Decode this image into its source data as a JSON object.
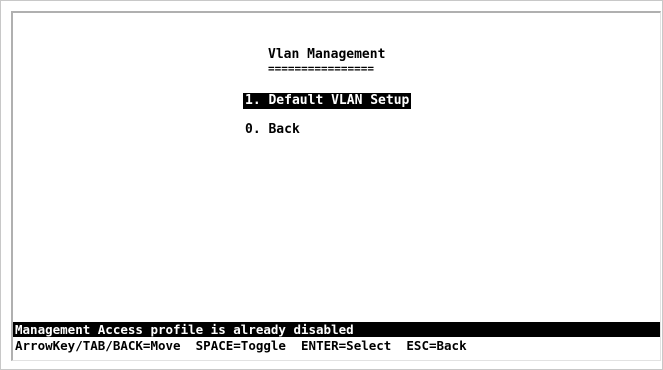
{
  "screen": {
    "title": "Vlan Management",
    "title_underline": "================"
  },
  "menu": {
    "items": [
      {
        "label": "1. Default VLAN Setup",
        "selected": true
      },
      {
        "label": "0. Back",
        "selected": false
      }
    ]
  },
  "status": {
    "message": "Management Access profile is already disabled"
  },
  "help": {
    "move": "ArrowKey/TAB/BACK=Move",
    "toggle": "SPACE=Toggle",
    "select": "ENTER=Select",
    "back": "ESC=Back"
  },
  "colors": {
    "background": "#ffffff",
    "text": "#000000",
    "highlight_bg": "#000000",
    "highlight_text": "#ffffff"
  }
}
